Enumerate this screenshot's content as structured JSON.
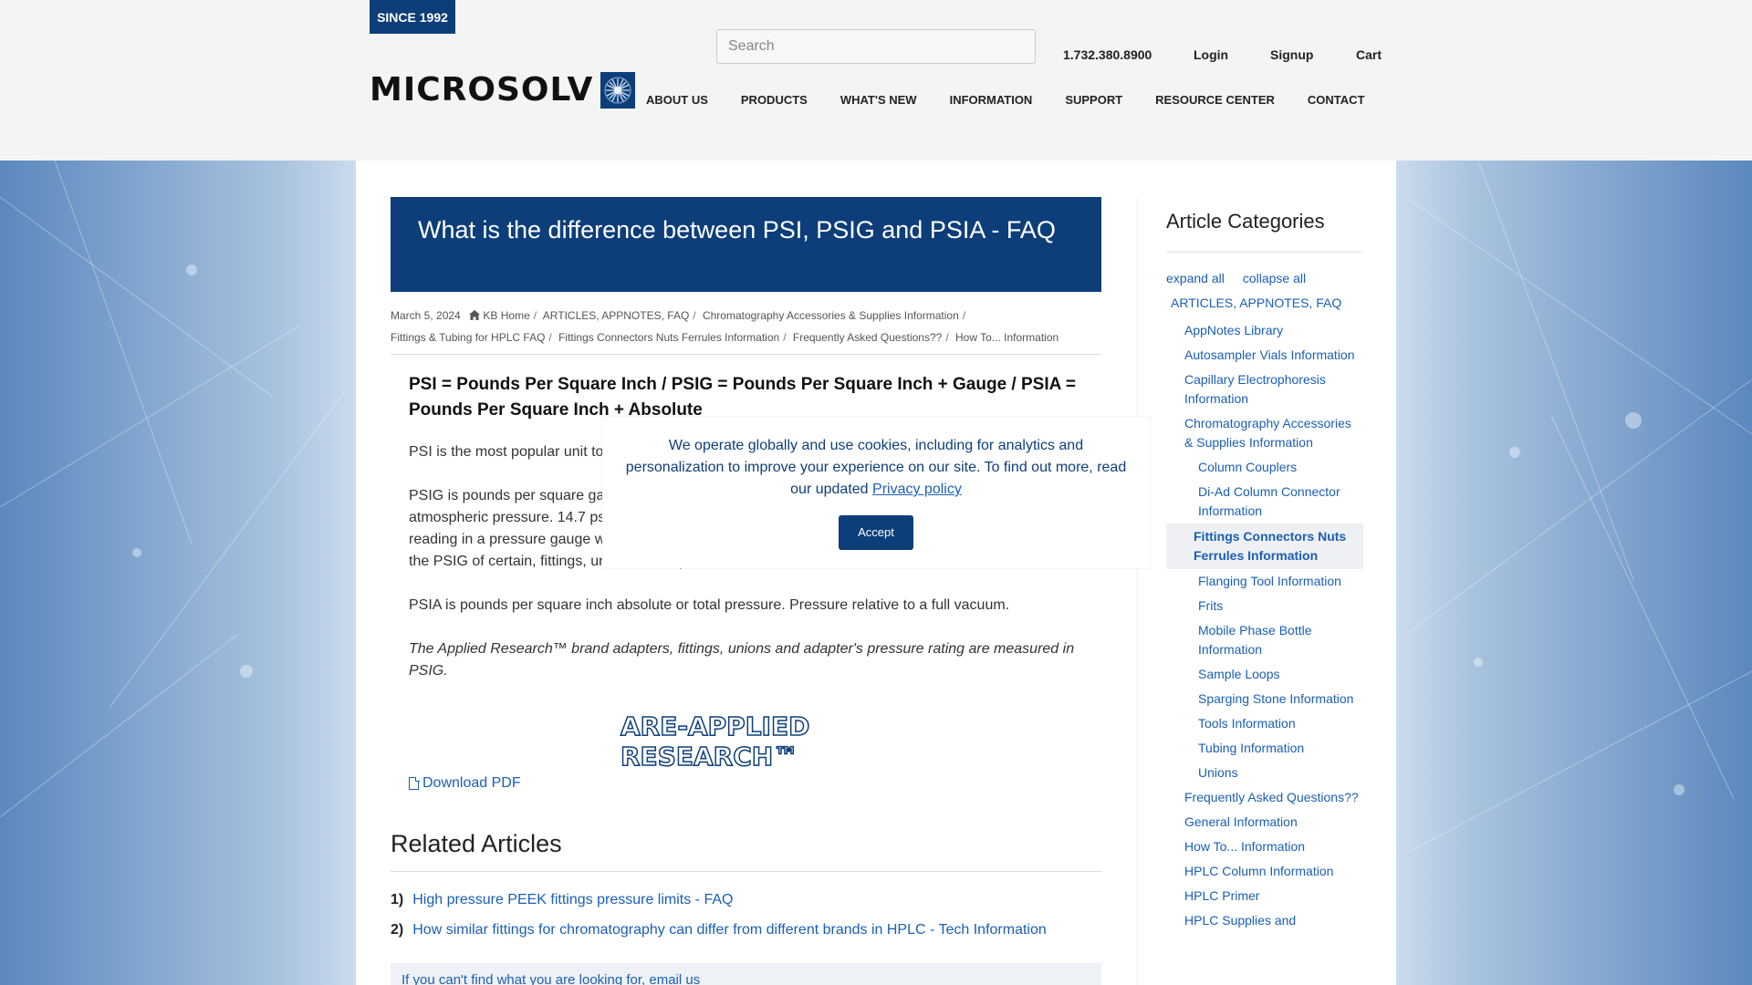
{
  "header": {
    "since_badge": "SINCE 1992",
    "logo_text": "MICROSOLV",
    "search_placeholder": "Search",
    "phone": "1.732.380.8900",
    "login": "Login",
    "signup": "Signup",
    "cart": "Cart"
  },
  "nav": {
    "items": [
      "ABOUT US",
      "PRODUCTS",
      "WHAT'S NEW",
      "INFORMATION",
      "SUPPORT",
      "RESOURCE CENTER",
      "CONTACT"
    ]
  },
  "article": {
    "title": "What is the difference between PSI, PSIG and PSIA - FAQ",
    "date": "March 5, 2024",
    "breadcrumb": [
      "KB Home",
      "ARTICLES, APPNOTES, FAQ",
      "Chromatography Accessories & Supplies Information",
      "Fittings & Tubing for HPLC FAQ",
      "Fittings Connectors Nuts Ferrules Information",
      "Frequently Asked Questions??",
      "How To... Information"
    ],
    "heading": "PSI = Pounds Per Square Inch / PSIG = Pounds Per Square Inch + Gauge / PSIA = Pounds Per Square Inch + Absolute",
    "p1": "PSI is the most popular unit to measure, meaning it is compa",
    "p2a": "PSIG is pounds per square ga",
    "p2b": "atmospheric pressure. 14.7 ps",
    "p2c": "reading in a pressure gauge which does not include atmospheric pressure. This can be used to calculate the PSIG of certain, fittings, unions or adapters.",
    "p3": "PSIA is pounds per square inch absolute or total pressure. Pressure relative to a full vacuum.",
    "p4": "The Applied Research™ brand adapters, fittings, unions and adapter's pressure rating are measured in PSIG.",
    "brand_logo": "ARE-APPLIED RESEARCH™",
    "download": "Download PDF"
  },
  "related": {
    "title": "Related Articles",
    "items": [
      {
        "num": "1)",
        "label": "High pressure PEEK fittings pressure limits - FAQ"
      },
      {
        "num": "2)",
        "label": "How similar fittings for chromatography can differ from different brands in HPLC - Tech Information"
      }
    ],
    "footer_note": "If you can't find what you are looking for, email us"
  },
  "sidebar": {
    "title": "Article Categories",
    "expand_all": "expand all",
    "collapse_all": "collapse all",
    "categories": [
      {
        "label": "ARTICLES, APPNOTES, FAQ",
        "level": 0
      },
      {
        "label": "AppNotes Library",
        "level": 1
      },
      {
        "label": "Autosampler Vials Information",
        "level": 1
      },
      {
        "label": "Capillary Electrophoresis Information",
        "level": 1
      },
      {
        "label": "Chromatography Accessories & Supplies Information",
        "level": 1
      },
      {
        "label": "Column Couplers",
        "level": 2
      },
      {
        "label": "Di-Ad Column Connector Information",
        "level": 2
      },
      {
        "label": "Fittings Connectors Nuts Ferrules Information",
        "level": 2,
        "active": true
      },
      {
        "label": "Flanging Tool Information",
        "level": 2
      },
      {
        "label": "Frits",
        "level": 2
      },
      {
        "label": "Mobile Phase Bottle Information",
        "level": 2
      },
      {
        "label": "Sample Loops",
        "level": 2
      },
      {
        "label": "Sparging Stone Information",
        "level": 2
      },
      {
        "label": "Tools Information",
        "level": 2
      },
      {
        "label": "Tubing Information",
        "level": 2
      },
      {
        "label": "Unions",
        "level": 2
      },
      {
        "label": "Frequently Asked Questions??",
        "level": 1
      },
      {
        "label": "General Information",
        "level": 1
      },
      {
        "label": "How To... Information",
        "level": 1
      },
      {
        "label": "HPLC Column Information",
        "level": 1
      },
      {
        "label": "HPLC Primer",
        "level": 1
      },
      {
        "label": "HPLC Supplies and",
        "level": 1
      }
    ]
  },
  "cookie": {
    "text": "We operate globally and use cookies, including for analytics and personalization to improve your experience on our site. To find out more, read our updated",
    "link": "Privacy policy",
    "accept": "Accept"
  },
  "colors": {
    "brand_navy": "#0d3e7a",
    "link_blue": "#1a5fb4"
  }
}
